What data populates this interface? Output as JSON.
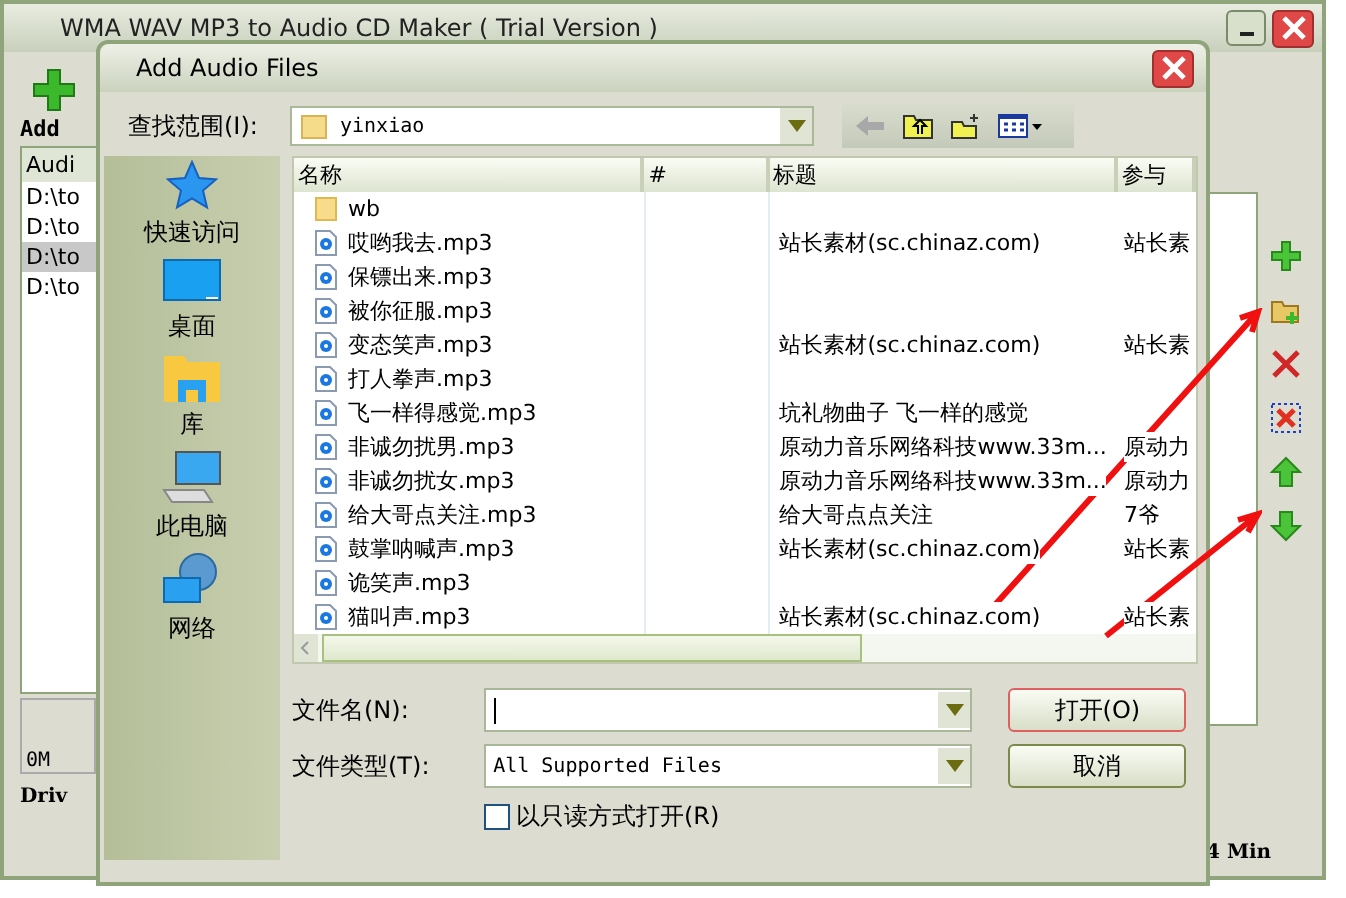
{
  "main_window": {
    "title": "WMA WAV MP3 to Audio CD Maker ( Trial Version )",
    "add_label": "Add",
    "list_header": "Audi",
    "list_items": [
      {
        "text": "D:\\to",
        "selected": false
      },
      {
        "text": "D:\\to",
        "selected": false
      },
      {
        "text": "D:\\to",
        "selected": true
      },
      {
        "text": "D:\\to",
        "selected": false
      }
    ],
    "size_reading": "0M",
    "drive_label": "Driv",
    "duration": "4 Min"
  },
  "dialog": {
    "title": "Add Audio Files",
    "look_in_label": "查找范围(I):",
    "look_in_value": "yinxiao",
    "places": [
      {
        "label": "快速访问",
        "kind": "star"
      },
      {
        "label": "桌面",
        "kind": "desktop"
      },
      {
        "label": "库",
        "kind": "library"
      },
      {
        "label": "此电脑",
        "kind": "computer"
      },
      {
        "label": "网络",
        "kind": "network"
      }
    ],
    "columns": [
      "名称",
      "#",
      "标题",
      "参与"
    ],
    "rows": [
      {
        "kind": "folder",
        "name": "wb"
      },
      {
        "kind": "audio",
        "name": "哎哟我去.mp3",
        "title": "站长素材(sc.chinaz.com)",
        "artist": "站长素"
      },
      {
        "kind": "audio",
        "name": "保镖出来.mp3"
      },
      {
        "kind": "audio",
        "name": "被你征服.mp3"
      },
      {
        "kind": "audio",
        "name": "变态笑声.mp3",
        "title": "站长素材(sc.chinaz.com)",
        "artist": "站长素"
      },
      {
        "kind": "audio",
        "name": "打人拳声.mp3"
      },
      {
        "kind": "audio",
        "name": "飞一样得感觉.mp3",
        "title": "坑礼物曲子 飞一样的感觉"
      },
      {
        "kind": "audio",
        "name": "非诚勿扰男.mp3",
        "title": "原动力音乐网络科技www.33m...",
        "artist": "原动力"
      },
      {
        "kind": "audio",
        "name": "非诚勿扰女.mp3",
        "title": "原动力音乐网络科技www.33m...",
        "artist": "原动力"
      },
      {
        "kind": "audio",
        "name": "给大哥点关注.mp3",
        "title": "给大哥点点关注",
        "artist": "7爷"
      },
      {
        "kind": "audio",
        "name": "鼓掌呐喊声.mp3",
        "title": "站长素材(sc.chinaz.com)",
        "artist": "站长素"
      },
      {
        "kind": "audio",
        "name": "诡笑声.mp3"
      },
      {
        "kind": "audio",
        "name": "猫叫声.mp3",
        "title": "站长素材(sc.chinaz.com)",
        "artist": "站长素"
      }
    ],
    "file_name_label": "文件名(N):",
    "file_type_label": "文件类型(T):",
    "file_type_value": "All Supported Files",
    "readonly_label": "以只读方式打开(R)",
    "readonly_checked": false,
    "open_button": "打开(O)",
    "cancel_button": "取消"
  }
}
